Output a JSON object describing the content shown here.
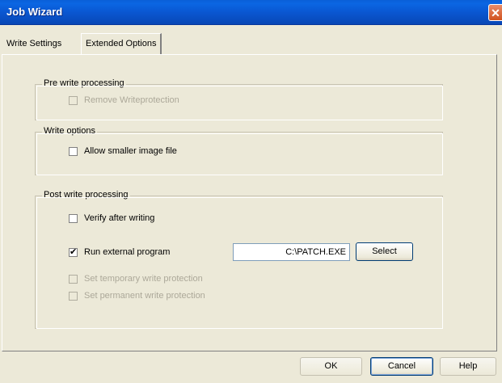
{
  "window": {
    "title": "Job Wizard",
    "close_glyph": "✕"
  },
  "tabs": [
    {
      "label": "Write Settings",
      "active": false
    },
    {
      "label": "Extended Options",
      "active": true
    }
  ],
  "groups": {
    "pre_write": {
      "legend": "Pre write processing",
      "items": [
        {
          "label": "Remove Writeprotection",
          "checked": false,
          "enabled": false
        }
      ]
    },
    "write_options": {
      "legend": "Write options",
      "items": [
        {
          "label": "Allow smaller image file",
          "checked": false,
          "enabled": true
        }
      ]
    },
    "post_write": {
      "legend": "Post write processing",
      "items": [
        {
          "label": "Verify after writing",
          "checked": false,
          "enabled": true
        },
        {
          "label": "Run external program",
          "checked": true,
          "enabled": true
        },
        {
          "label": "Set temporary write protection",
          "checked": false,
          "enabled": false
        },
        {
          "label": "Set permanent write protection",
          "checked": false,
          "enabled": false
        }
      ],
      "program_path": "C:\\PATCH.EXE",
      "select_label": "Select"
    }
  },
  "footer": {
    "ok_label": "OK",
    "cancel_label": "Cancel",
    "help_label": "Help"
  }
}
